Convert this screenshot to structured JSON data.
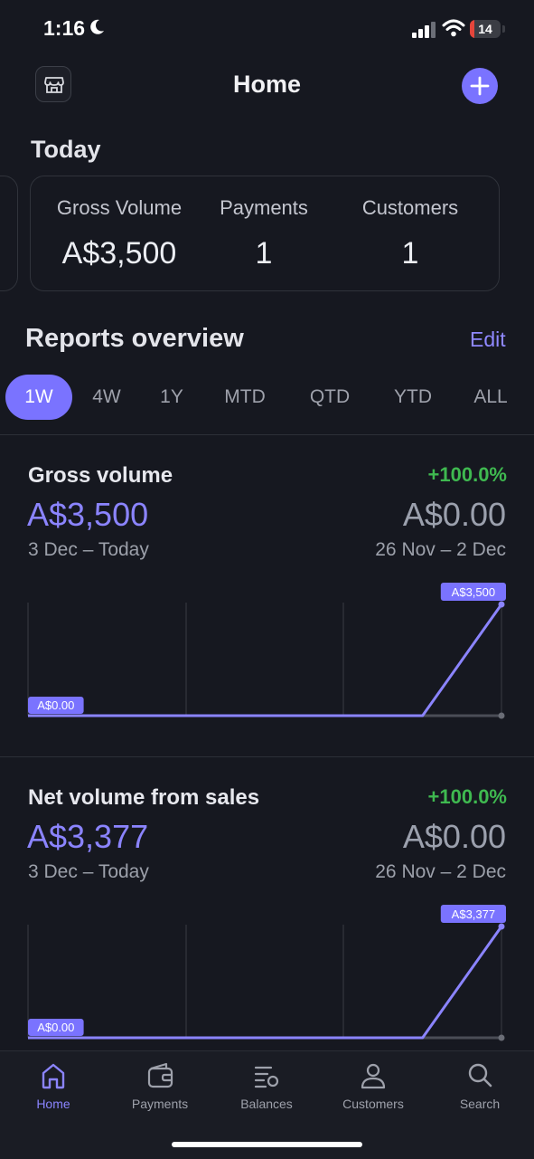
{
  "status_bar": {
    "time": "1:16",
    "battery": "14",
    "battery_fraction": 0.14
  },
  "header": {
    "title": "Home",
    "left_icon": "store-icon",
    "right_icon": "plus-icon"
  },
  "today": {
    "title": "Today",
    "stats": [
      {
        "label": "Gross Volume",
        "value": "A$3,500"
      },
      {
        "label": "Payments",
        "value": "1"
      },
      {
        "label": "Customers",
        "value": "1"
      }
    ]
  },
  "reports": {
    "title": "Reports overview",
    "edit_label": "Edit",
    "periods": [
      "1W",
      "4W",
      "1Y",
      "MTD",
      "QTD",
      "YTD",
      "ALL"
    ],
    "active_period": "1W"
  },
  "charts": [
    {
      "title": "Gross volume",
      "change": "+100.0%",
      "current_value": "A$3,500",
      "previous_value": "A$0.00",
      "current_range": "3 Dec – Today",
      "previous_range": "26 Nov – 2 Dec",
      "min_label": "A$0.00",
      "max_label": "A$3,500"
    },
    {
      "title": "Net volume from sales",
      "change": "+100.0%",
      "current_value": "A$3,377",
      "previous_value": "A$0.00",
      "current_range": "3 Dec – Today",
      "previous_range": "26 Nov – 2 Dec",
      "min_label": "A$0.00",
      "max_label": "A$3,377"
    }
  ],
  "chart_data": [
    {
      "type": "line",
      "title": "Gross volume",
      "series": [
        {
          "values": [
            0,
            0,
            0,
            0,
            0,
            0,
            3500
          ]
        },
        {
          "values": [
            0,
            0,
            0,
            0,
            0,
            0,
            0
          ]
        }
      ],
      "ylim": [
        0,
        3500
      ],
      "grid": true
    },
    {
      "type": "line",
      "title": "Net volume from sales",
      "series": [
        {
          "values": [
            0,
            0,
            0,
            0,
            0,
            0,
            3377
          ]
        },
        {
          "values": [
            0,
            0,
            0,
            0,
            0,
            0,
            0
          ]
        }
      ],
      "ylim": [
        0,
        3377
      ],
      "grid": true
    }
  ],
  "tabbar": {
    "items": [
      {
        "label": "Home",
        "icon": "home-icon",
        "active": true
      },
      {
        "label": "Payments",
        "icon": "wallet-icon",
        "active": false
      },
      {
        "label": "Balances",
        "icon": "balances-icon",
        "active": false
      },
      {
        "label": "Customers",
        "icon": "person-icon",
        "active": false
      },
      {
        "label": "Search",
        "icon": "search-icon",
        "active": false
      }
    ]
  },
  "colors": {
    "accent": "#7a73ff",
    "accent_text": "#8b84ff",
    "positive": "#3fb950",
    "background": "#161820",
    "previous_line": "#4a4d56"
  }
}
